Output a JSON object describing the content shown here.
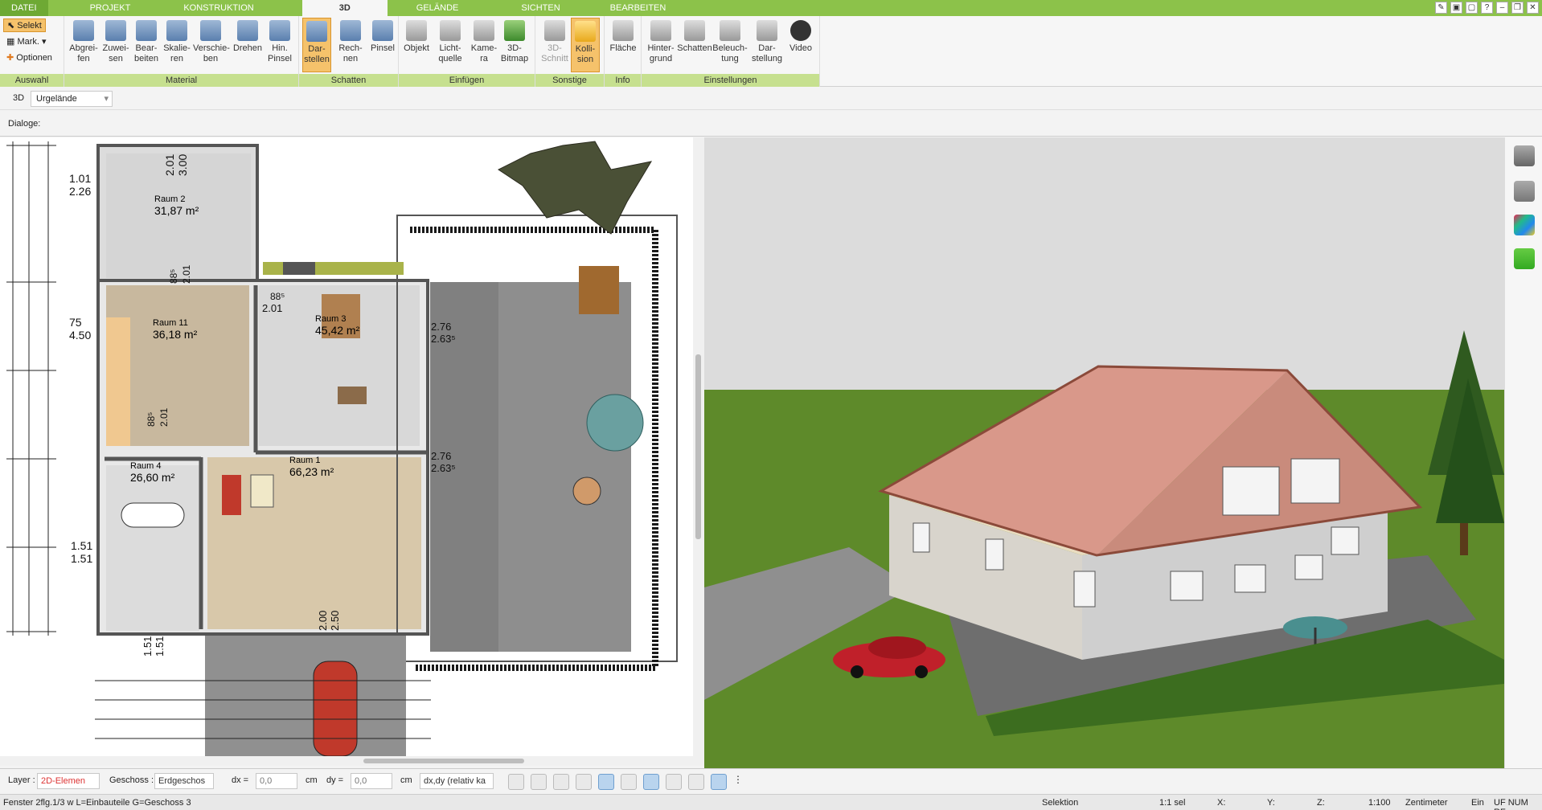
{
  "tabs": [
    "DATEI",
    "PROJEKT",
    "KONSTRUKTION",
    "3D",
    "GELÄNDE",
    "SICHTEN",
    "BEARBEITEN"
  ],
  "ribbon": {
    "auswahl": {
      "select": "Selekt",
      "mark": "Mark.",
      "options": "Optionen",
      "label": "Auswahl"
    },
    "material": {
      "label": "Material",
      "buttons": [
        "Abgrei-\nfen",
        "Zuwei-\nsen",
        "Bear-\nbeiten",
        "Skalie-\nren",
        "Verschie-\nben",
        "Drehen",
        "Hin.\nPinsel"
      ]
    },
    "schatten": {
      "label": "Schatten",
      "buttons": [
        "Dar-\nstellen",
        "Rech-\nnen",
        "Pinsel"
      ]
    },
    "einfuegen": {
      "label": "Einfügen",
      "buttons": [
        "Objekt",
        "Licht-\nquelle",
        "Kame-\nra",
        "3D-\nBitmap"
      ]
    },
    "sonstige": {
      "label": "Sonstige",
      "buttons": [
        "3D-\nSchnitt",
        "Kolli-\nsion"
      ]
    },
    "info": {
      "label": "Info",
      "buttons": [
        "Fläche"
      ]
    },
    "einstellungen": {
      "label": "Einstellungen",
      "buttons": [
        "Hinter-\ngrund",
        "Schatten",
        "Beleuch-\ntung",
        "Dar-\nstellung",
        "Video"
      ]
    }
  },
  "view_bar": {
    "mode": "3D",
    "terrain": "Urgelände",
    "dialogs_label": "Dialoge:"
  },
  "rooms": [
    {
      "name": "Raum 2",
      "area": "31,87 m²"
    },
    {
      "name": "Raum 11",
      "area": "36,18 m²"
    },
    {
      "name": "Raum 3",
      "area": "45,42 m²"
    },
    {
      "name": "Raum 1",
      "area": "66,23 m²"
    },
    {
      "name": "Raum 4",
      "area": "26,60 m²"
    }
  ],
  "dims": {
    "d1": "2.01",
    "d2": "3.00",
    "d3": "1.01",
    "d4": "2.26",
    "d5": "88⁵",
    "d6": "2.01",
    "d7": "88⁵",
    "d8": "2.01",
    "d9": "75",
    "d10": "4.50",
    "d11": "2.76",
    "d12": "2.63⁵",
    "d13": "88⁵",
    "d14": "2.01",
    "d15": "2.76",
    "d16": "2.63⁵",
    "d17": "1.51",
    "d18": "1.51",
    "d19": "2.00",
    "d20": "2.50",
    "d21": "1.51",
    "d22": "1.51"
  },
  "bottom_toolbar": {
    "layer_label": "Layer :",
    "layer_value": "2D-Elemen",
    "floor_label": "Geschoss :",
    "floor_value": "Erdgeschos",
    "dx_label": "dx =",
    "dx_value": "0,0",
    "dy_label": "dy =",
    "dy_value": "0,0",
    "unit": "cm",
    "mode_value": "dx,dy (relativ ka"
  },
  "status": {
    "left": "Fenster 2flg.1/3 w L=Einbauteile G=Geschoss 3",
    "mode": "Selektion",
    "scale_sel": "1:1 sel",
    "x": "X:",
    "y": "Y:",
    "z": "Z:",
    "ratio": "1:100",
    "unit": "Zentimeter",
    "ein": "Ein",
    "flags": "UF NUM RF"
  },
  "colors": {
    "ribbon_green": "#8cc24a",
    "group_label": "#c6e08f",
    "active": "#f5c26b"
  }
}
